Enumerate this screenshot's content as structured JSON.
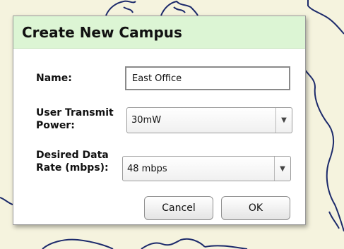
{
  "dialog": {
    "title": "Create New Campus",
    "name_label": "Name:",
    "name_value": "East Office",
    "power_label": "User Transmit\nPower:",
    "power_value": "30mW",
    "rate_label": "Desired Data\nRate (mbps):",
    "rate_value": "48 mbps",
    "cancel_label": "Cancel",
    "ok_label": "OK"
  },
  "icons": {
    "dropdown_arrow": "chevron-down-icon"
  },
  "colors": {
    "header_bg": "#dcf5d4",
    "map_bg": "#f5f3de",
    "map_lines": "#1c2a6b"
  }
}
